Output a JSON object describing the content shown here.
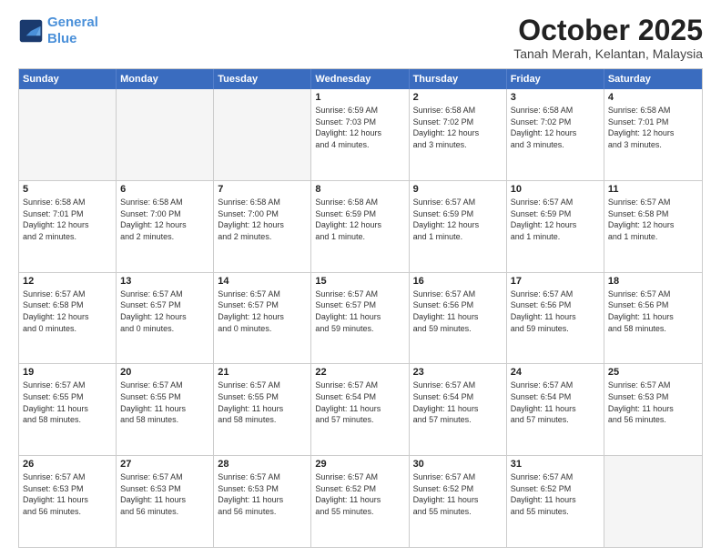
{
  "logo": {
    "line1": "General",
    "line2": "Blue"
  },
  "title": "October 2025",
  "location": "Tanah Merah, Kelantan, Malaysia",
  "weekdays": [
    "Sunday",
    "Monday",
    "Tuesday",
    "Wednesday",
    "Thursday",
    "Friday",
    "Saturday"
  ],
  "rows": [
    [
      {
        "day": "",
        "info": ""
      },
      {
        "day": "",
        "info": ""
      },
      {
        "day": "",
        "info": ""
      },
      {
        "day": "1",
        "info": "Sunrise: 6:59 AM\nSunset: 7:03 PM\nDaylight: 12 hours\nand 4 minutes."
      },
      {
        "day": "2",
        "info": "Sunrise: 6:58 AM\nSunset: 7:02 PM\nDaylight: 12 hours\nand 3 minutes."
      },
      {
        "day": "3",
        "info": "Sunrise: 6:58 AM\nSunset: 7:02 PM\nDaylight: 12 hours\nand 3 minutes."
      },
      {
        "day": "4",
        "info": "Sunrise: 6:58 AM\nSunset: 7:01 PM\nDaylight: 12 hours\nand 3 minutes."
      }
    ],
    [
      {
        "day": "5",
        "info": "Sunrise: 6:58 AM\nSunset: 7:01 PM\nDaylight: 12 hours\nand 2 minutes."
      },
      {
        "day": "6",
        "info": "Sunrise: 6:58 AM\nSunset: 7:00 PM\nDaylight: 12 hours\nand 2 minutes."
      },
      {
        "day": "7",
        "info": "Sunrise: 6:58 AM\nSunset: 7:00 PM\nDaylight: 12 hours\nand 2 minutes."
      },
      {
        "day": "8",
        "info": "Sunrise: 6:58 AM\nSunset: 6:59 PM\nDaylight: 12 hours\nand 1 minute."
      },
      {
        "day": "9",
        "info": "Sunrise: 6:57 AM\nSunset: 6:59 PM\nDaylight: 12 hours\nand 1 minute."
      },
      {
        "day": "10",
        "info": "Sunrise: 6:57 AM\nSunset: 6:59 PM\nDaylight: 12 hours\nand 1 minute."
      },
      {
        "day": "11",
        "info": "Sunrise: 6:57 AM\nSunset: 6:58 PM\nDaylight: 12 hours\nand 1 minute."
      }
    ],
    [
      {
        "day": "12",
        "info": "Sunrise: 6:57 AM\nSunset: 6:58 PM\nDaylight: 12 hours\nand 0 minutes."
      },
      {
        "day": "13",
        "info": "Sunrise: 6:57 AM\nSunset: 6:57 PM\nDaylight: 12 hours\nand 0 minutes."
      },
      {
        "day": "14",
        "info": "Sunrise: 6:57 AM\nSunset: 6:57 PM\nDaylight: 12 hours\nand 0 minutes."
      },
      {
        "day": "15",
        "info": "Sunrise: 6:57 AM\nSunset: 6:57 PM\nDaylight: 11 hours\nand 59 minutes."
      },
      {
        "day": "16",
        "info": "Sunrise: 6:57 AM\nSunset: 6:56 PM\nDaylight: 11 hours\nand 59 minutes."
      },
      {
        "day": "17",
        "info": "Sunrise: 6:57 AM\nSunset: 6:56 PM\nDaylight: 11 hours\nand 59 minutes."
      },
      {
        "day": "18",
        "info": "Sunrise: 6:57 AM\nSunset: 6:56 PM\nDaylight: 11 hours\nand 58 minutes."
      }
    ],
    [
      {
        "day": "19",
        "info": "Sunrise: 6:57 AM\nSunset: 6:55 PM\nDaylight: 11 hours\nand 58 minutes."
      },
      {
        "day": "20",
        "info": "Sunrise: 6:57 AM\nSunset: 6:55 PM\nDaylight: 11 hours\nand 58 minutes."
      },
      {
        "day": "21",
        "info": "Sunrise: 6:57 AM\nSunset: 6:55 PM\nDaylight: 11 hours\nand 58 minutes."
      },
      {
        "day": "22",
        "info": "Sunrise: 6:57 AM\nSunset: 6:54 PM\nDaylight: 11 hours\nand 57 minutes."
      },
      {
        "day": "23",
        "info": "Sunrise: 6:57 AM\nSunset: 6:54 PM\nDaylight: 11 hours\nand 57 minutes."
      },
      {
        "day": "24",
        "info": "Sunrise: 6:57 AM\nSunset: 6:54 PM\nDaylight: 11 hours\nand 57 minutes."
      },
      {
        "day": "25",
        "info": "Sunrise: 6:57 AM\nSunset: 6:53 PM\nDaylight: 11 hours\nand 56 minutes."
      }
    ],
    [
      {
        "day": "26",
        "info": "Sunrise: 6:57 AM\nSunset: 6:53 PM\nDaylight: 11 hours\nand 56 minutes."
      },
      {
        "day": "27",
        "info": "Sunrise: 6:57 AM\nSunset: 6:53 PM\nDaylight: 11 hours\nand 56 minutes."
      },
      {
        "day": "28",
        "info": "Sunrise: 6:57 AM\nSunset: 6:53 PM\nDaylight: 11 hours\nand 56 minutes."
      },
      {
        "day": "29",
        "info": "Sunrise: 6:57 AM\nSunset: 6:52 PM\nDaylight: 11 hours\nand 55 minutes."
      },
      {
        "day": "30",
        "info": "Sunrise: 6:57 AM\nSunset: 6:52 PM\nDaylight: 11 hours\nand 55 minutes."
      },
      {
        "day": "31",
        "info": "Sunrise: 6:57 AM\nSunset: 6:52 PM\nDaylight: 11 hours\nand 55 minutes."
      },
      {
        "day": "",
        "info": ""
      }
    ]
  ]
}
